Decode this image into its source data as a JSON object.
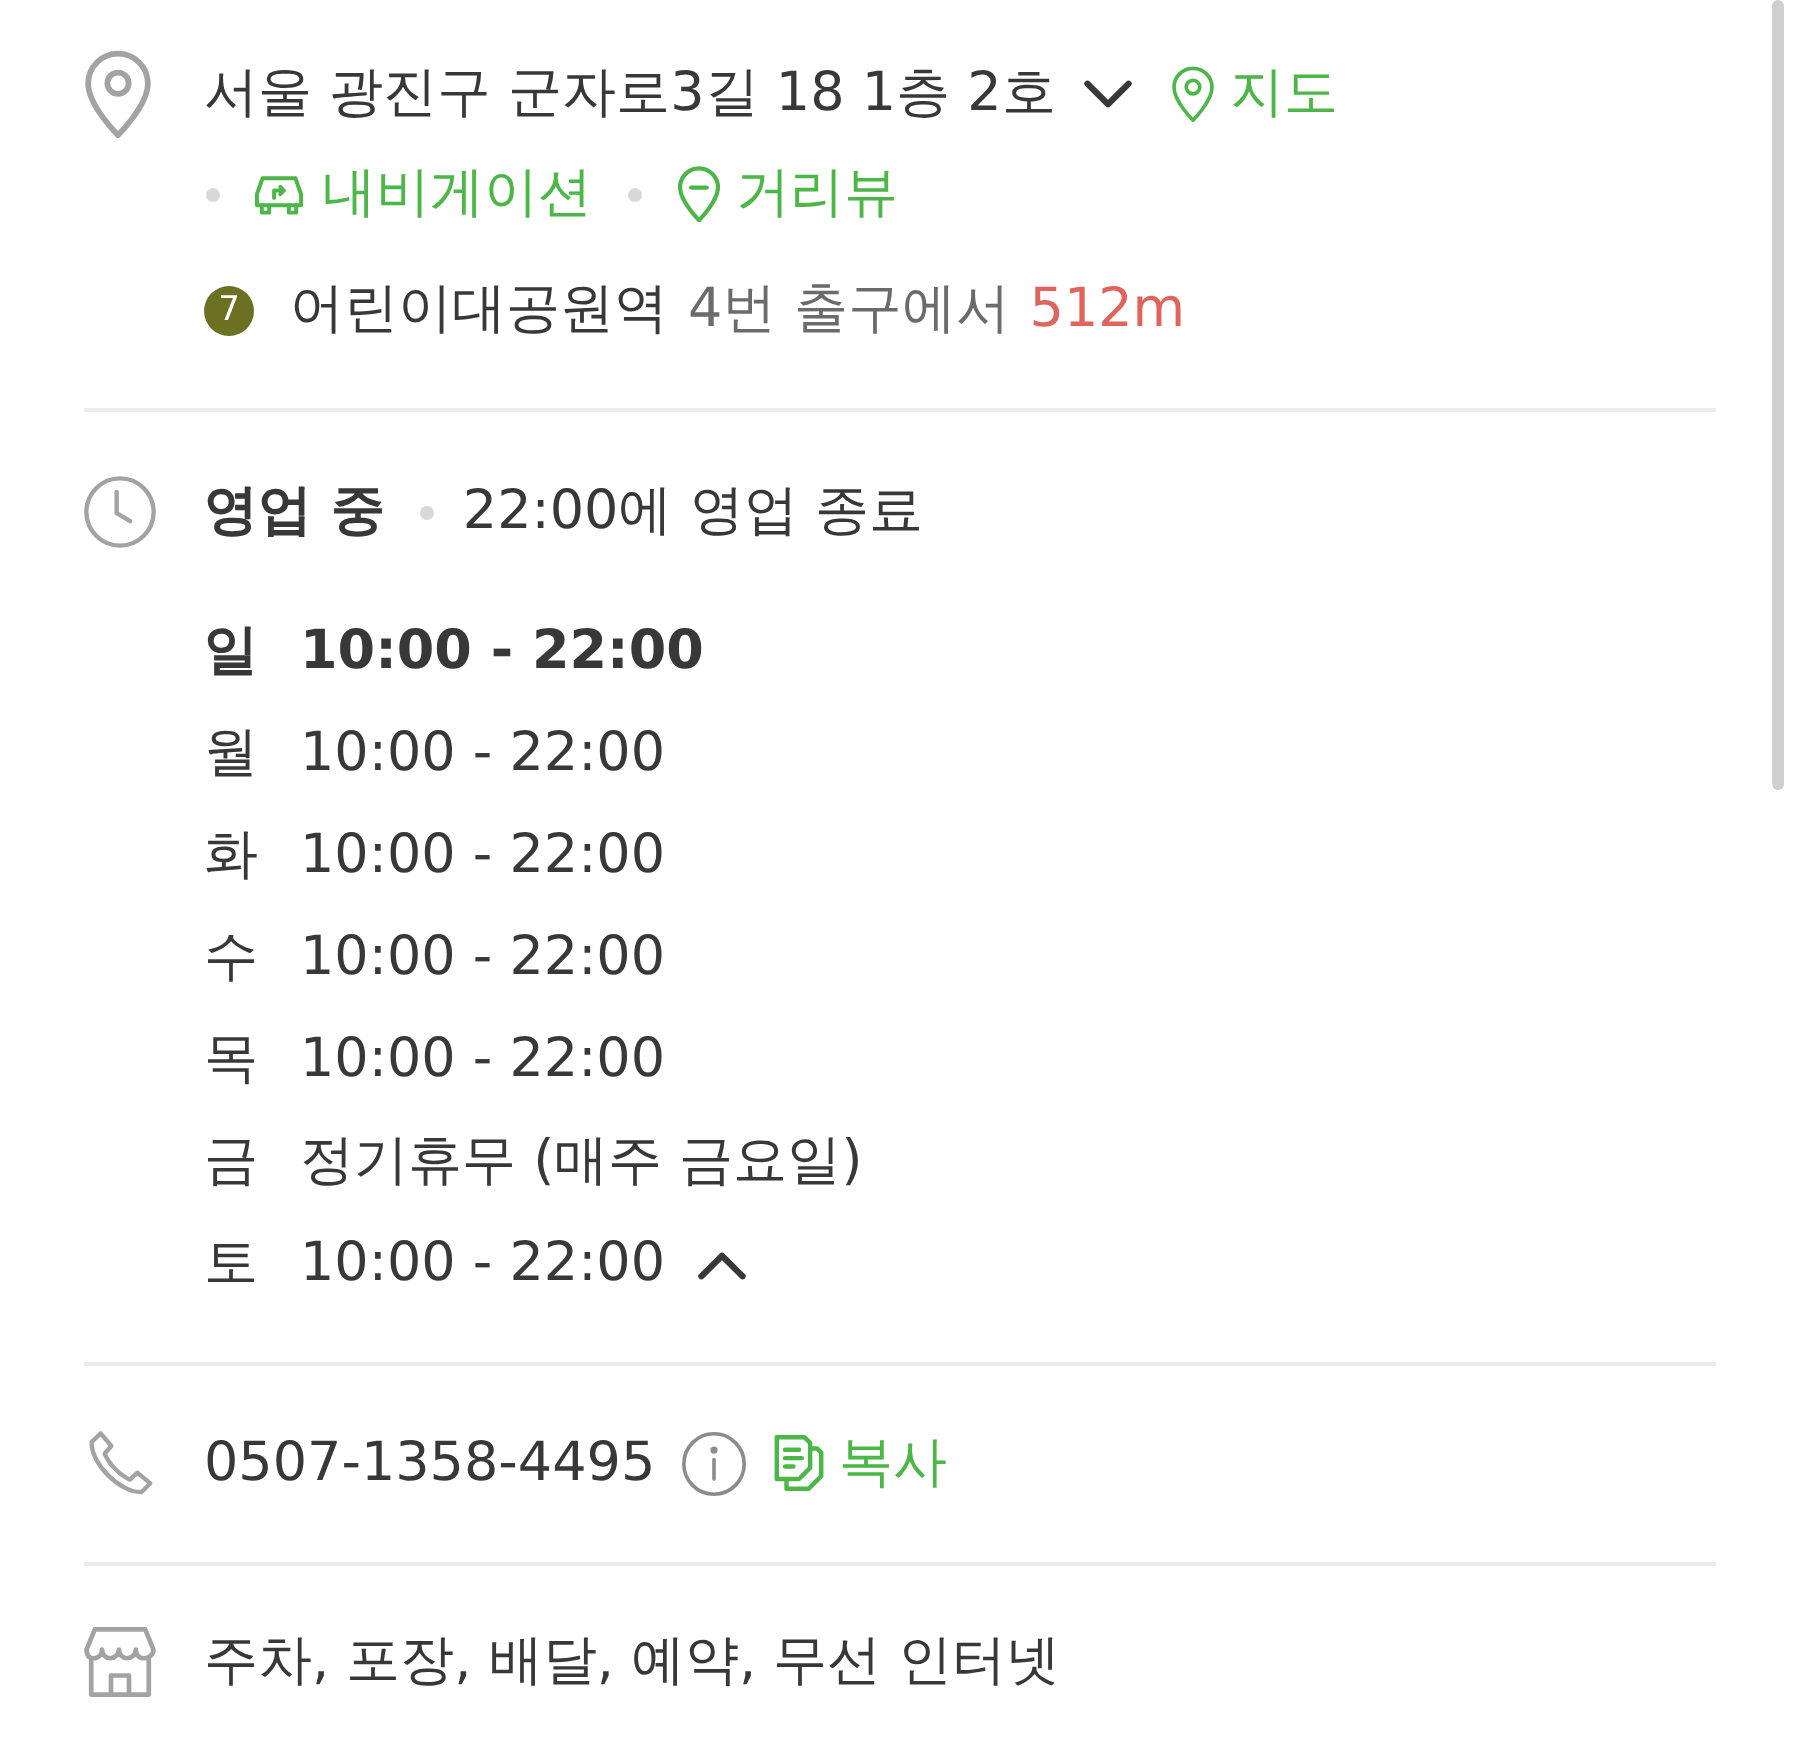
{
  "address": {
    "text": "서울 광진구 군자로3길 18 1층 2호",
    "expanded": false,
    "links": [
      {
        "kind": "map",
        "label": "지도"
      },
      {
        "kind": "navigation",
        "label": "내비게이션"
      },
      {
        "kind": "street_view",
        "label": "거리뷰"
      }
    ]
  },
  "subway": [
    {
      "line": "7",
      "color": "#6b7023",
      "station": "어린이대공원역",
      "exit": "4번 출구에서",
      "distance": "512m"
    }
  ],
  "hours": {
    "status": "영업 중",
    "note": "22:00에 영업 종료",
    "expanded": true,
    "days": [
      {
        "day": "일",
        "hours": "10:00 - 22:00",
        "today": true
      },
      {
        "day": "월",
        "hours": "10:00 - 22:00",
        "today": false
      },
      {
        "day": "화",
        "hours": "10:00 - 22:00",
        "today": false
      },
      {
        "day": "수",
        "hours": "10:00 - 22:00",
        "today": false
      },
      {
        "day": "목",
        "hours": "10:00 - 22:00",
        "today": false
      },
      {
        "day": "금",
        "hours": "정기휴무 (매주 금요일)",
        "today": false
      },
      {
        "day": "토",
        "hours": "10:00 - 22:00",
        "today": false
      }
    ]
  },
  "phone": {
    "number": "0507-1358-4495",
    "copy_label": "복사"
  },
  "amenities": "주차, 포장, 배달, 예약, 무선 인터넷"
}
